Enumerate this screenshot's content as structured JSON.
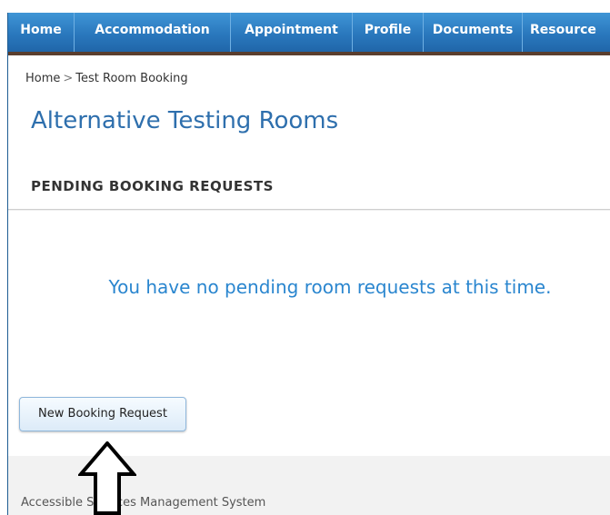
{
  "nav": {
    "items": [
      {
        "label": "Home"
      },
      {
        "label": "Accommodation"
      },
      {
        "label": "Appointment"
      },
      {
        "label": "Profile"
      },
      {
        "label": "Documents"
      },
      {
        "label": "Resource"
      }
    ]
  },
  "breadcrumb": {
    "home": "Home",
    "separator": ">",
    "current": "Test Room Booking"
  },
  "page": {
    "title": "Alternative Testing Rooms"
  },
  "section": {
    "header": "PENDING BOOKING REQUESTS",
    "empty_message": "You have no pending room requests at this time."
  },
  "actions": {
    "new_booking_label": "New Booking Request"
  },
  "footer": {
    "text": "Accessible Services Management System"
  },
  "colors": {
    "nav_blue": "#2a78bd",
    "title_blue": "#2e6fad",
    "message_blue": "#2a86cf",
    "nav_border_brown": "#5a3e2e"
  },
  "annotation": {
    "icon": "up-arrow-icon"
  }
}
